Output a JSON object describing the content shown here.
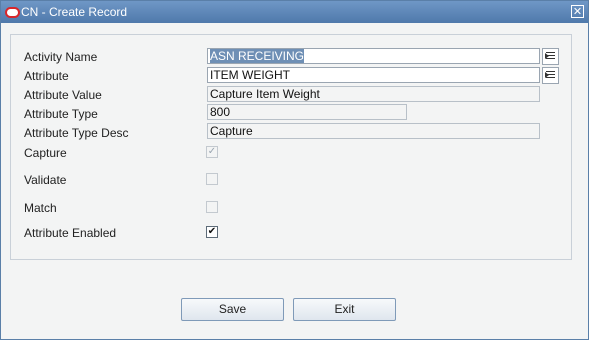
{
  "window": {
    "title": "CN - Create Record",
    "close_glyph": "✕",
    "logo_icon": "oracle-logo-icon"
  },
  "form": {
    "activity_name": {
      "label": "Activity Name",
      "value": "ASN RECEIVING"
    },
    "attribute": {
      "label": "Attribute",
      "value": "ITEM WEIGHT"
    },
    "attribute_value": {
      "label": "Attribute Value",
      "value": "Capture Item Weight"
    },
    "attribute_type": {
      "label": "Attribute Type",
      "value": "800"
    },
    "attribute_type_desc": {
      "label": "Attribute Type Desc",
      "value": "Capture"
    },
    "capture": {
      "label": "Capture",
      "checked": true,
      "enabled": false,
      "glyph": "✓"
    },
    "validate": {
      "label": "Validate",
      "checked": false,
      "enabled": false,
      "glyph": ""
    },
    "match": {
      "label": "Match",
      "checked": false,
      "enabled": false,
      "glyph": ""
    },
    "attribute_enabled": {
      "label": "Attribute Enabled",
      "checked": true,
      "enabled": true,
      "glyph": "✔"
    }
  },
  "buttons": {
    "save": "Save",
    "exit": "Exit"
  },
  "colors": {
    "titlebar": "#5b84b6",
    "selection": "#6e8fb5",
    "background": "#f3f4f4"
  }
}
